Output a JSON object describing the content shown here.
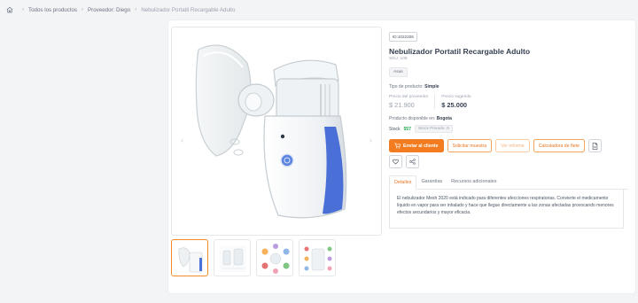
{
  "breadcrumb": {
    "items": [
      "Todos los productos",
      "Proveedor: Diego"
    ],
    "current": "Nebulizador Portatil Recargable Adulto"
  },
  "product": {
    "id_chip": "ID:1022206",
    "title": "Nebulizador Portatil Recargable Adulto",
    "sku": "SKU: 108",
    "tag": "Asas",
    "type_label": "Tipo de producto:",
    "type_value": "Simple",
    "price_provider_label": "Precio del proveedor",
    "price_provider": "$ 21.900",
    "price_suggested_label": "Precio sugerido",
    "price_suggested": "$ 25.000",
    "available_label": "Producto disponible en:",
    "available_city": "Bogota",
    "stock_label": "Stock",
    "stock_value": "557",
    "stock_private": "Stock Privado: 0"
  },
  "actions": {
    "send": "Enviar al cliente",
    "sample": "Solicitar muestra",
    "report": "Ver informe",
    "calculator": "Calculadora de flete"
  },
  "tabs": [
    "Detalles",
    "Garantías",
    "Recursos adicionales"
  ],
  "description": "El nebulizador Mesh 2020 está indicado para diferentes afecciones respiratorias. Convierte el medicamento líquido en vapor para ser inhalado y hace que llegue directamente a las zonas afectadas provocando menores efectos secundarios y mayor eficacia.",
  "colors": {
    "accent": "#f47c20",
    "stock_green": "#16a34a"
  },
  "gallery": {
    "thumb_count": 4,
    "active_thumb": 1
  }
}
